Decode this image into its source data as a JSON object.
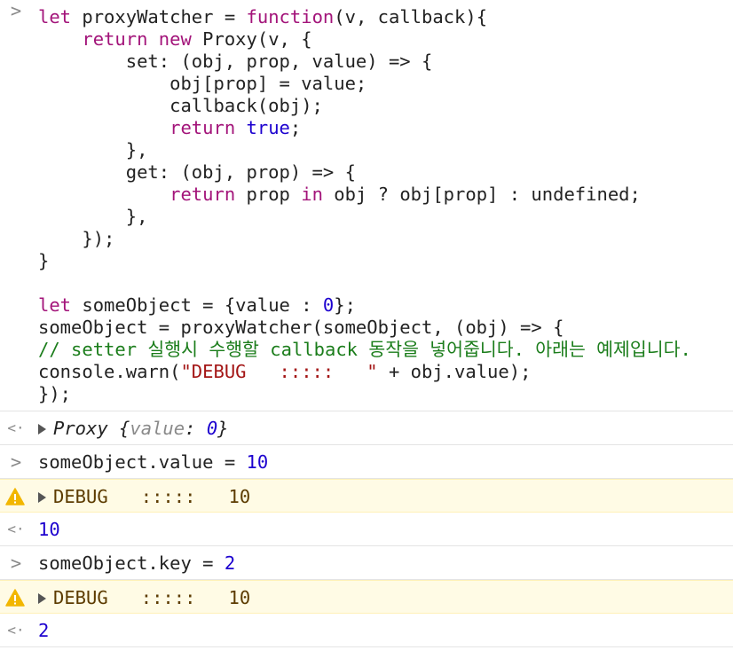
{
  "console": {
    "input_prompt": ">",
    "output_prompt": "<·",
    "code_block": {
      "l1_kw1": "let",
      "l1_a": " proxyWatcher = ",
      "l1_kw2": "function",
      "l1_b": "(v, callback){",
      "l2_indent": "    ",
      "l2_kw1": "return",
      "l2_sp": " ",
      "l2_kw2": "new",
      "l2_b": " Proxy(v, {",
      "l3": "        set: (obj, prop, value) => {",
      "l4": "            obj[prop] = value;",
      "l5": "            callback(obj);",
      "l6_indent": "            ",
      "l6_kw": "return",
      "l6_sp": " ",
      "l6_val": "true",
      "l6_end": ";",
      "l7": "        },",
      "l8": "        get: (obj, prop) => {",
      "l9_indent": "            ",
      "l9_kw1": "return",
      "l9_a": " prop ",
      "l9_kw2": "in",
      "l9_b": " obj ? obj[prop] : undefined;",
      "l10": "        },",
      "l11": "    });",
      "l12": "}",
      "l14_kw": "let",
      "l14_a": " someObject = {value : ",
      "l14_num": "0",
      "l14_b": "};",
      "l15": "someObject = proxyWatcher(someObject, (obj) => {",
      "l16_comment": "// setter 실행시 수행할 callback 동작을 넣어줍니다. 아래는 예제입니다.",
      "l17_a": "console.warn(",
      "l17_str": "\"DEBUG   :::::   \"",
      "l17_b": " + obj.value);",
      "l18": "});"
    },
    "entries": [
      {
        "kind": "result",
        "obj_name": "Proxy",
        "obj_open": " {",
        "key": "value",
        "colon": ": ",
        "val": "0",
        "obj_close": "}"
      },
      {
        "kind": "input",
        "code_a": "someObject.value = ",
        "code_num": "10"
      },
      {
        "kind": "warning",
        "label": "DEBUG",
        "separator": ":::::",
        "value": "10"
      },
      {
        "kind": "output",
        "value": "10"
      },
      {
        "kind": "input",
        "code_a": "someObject.key = ",
        "code_num": "2"
      },
      {
        "kind": "warning",
        "label": "DEBUG",
        "separator": ":::::",
        "value": "10"
      },
      {
        "kind": "output",
        "value": "2"
      }
    ]
  },
  "colors": {
    "keyword": "#a3147a",
    "number": "#1c00cf",
    "string": "#a31515",
    "comment": "#1b7d1b",
    "warning_bg": "#fffbe5",
    "warning_icon": "#f2b600"
  }
}
